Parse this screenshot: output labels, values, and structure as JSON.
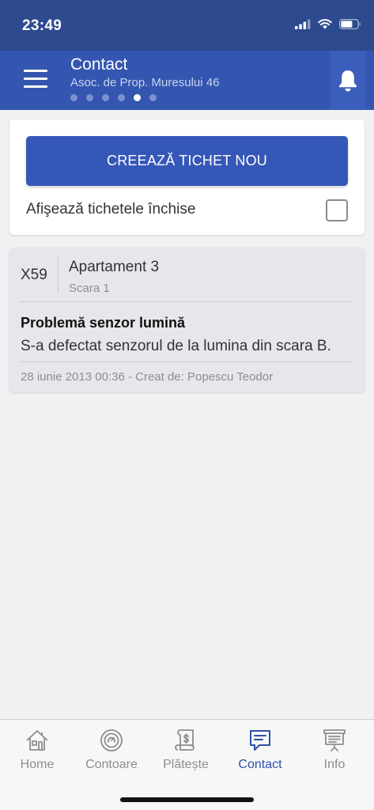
{
  "status_bar": {
    "time": "23:49"
  },
  "header": {
    "title": "Contact",
    "subtitle": "Asoc. de Prop. Muresului 46",
    "page_count": 6,
    "active_page": 5
  },
  "actions": {
    "create_ticket_label": "CREEAZĂ TICHET NOU",
    "show_closed_label": "Afişează tichetele închise",
    "show_closed_checked": false
  },
  "tickets": [
    {
      "id": "X59",
      "apartment": "Apartament 3",
      "staircase": "Scara 1",
      "title": "Problemă senzor lumină",
      "description": "S-a defectat senzorul de la lumina din scara B.",
      "meta": "28 iunie 2013 00:36 - Creat de: Popescu Teodor"
    }
  ],
  "tabs": [
    {
      "label": "Home",
      "icon": "home-icon"
    },
    {
      "label": "Contoare",
      "icon": "meter-icon"
    },
    {
      "label": "Plătește",
      "icon": "bill-icon"
    },
    {
      "label": "Contact",
      "icon": "chat-icon",
      "active": true
    },
    {
      "label": "Info",
      "icon": "info-board-icon"
    }
  ],
  "colors": {
    "primary": "#3557b7",
    "header": "#3456b0",
    "status_bar": "#2d4a8f",
    "tab_active": "#2e4fa8",
    "tab_inactive": "#8d8e92"
  }
}
